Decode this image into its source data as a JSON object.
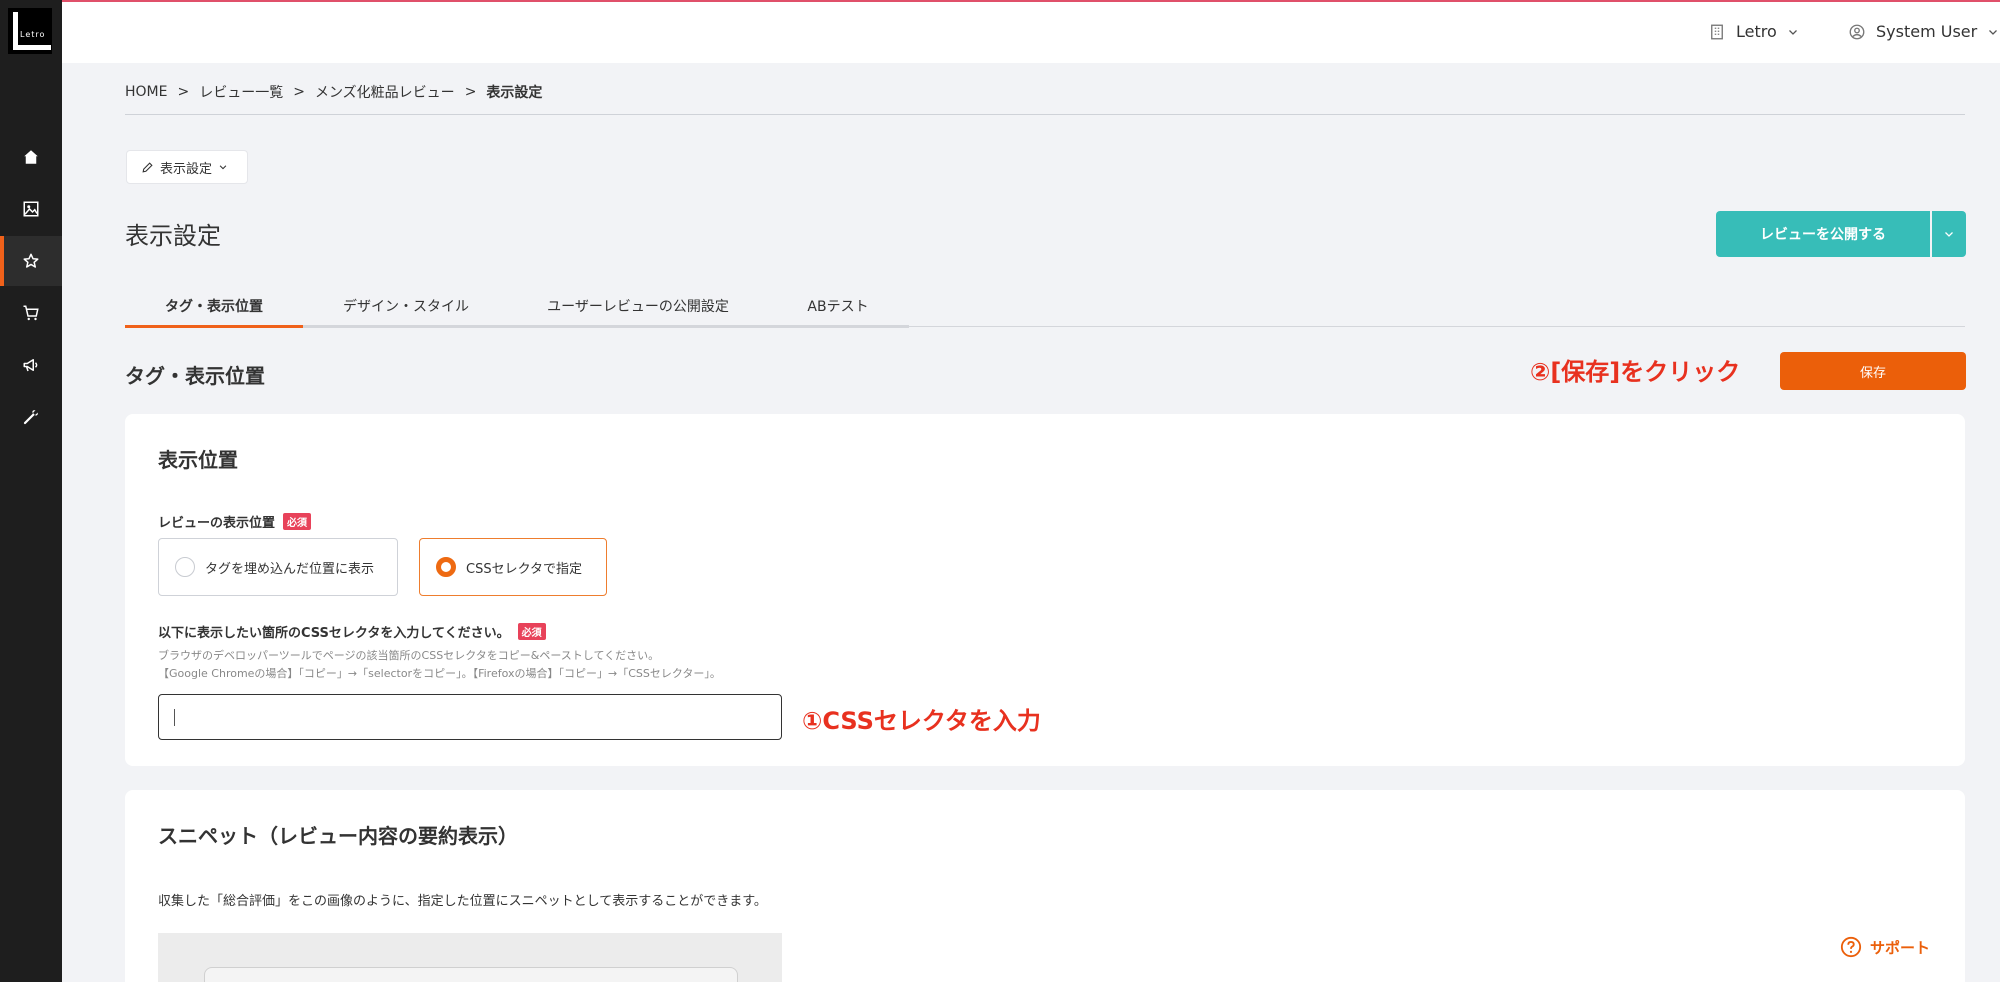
{
  "logo_text": "Letro",
  "header": {
    "org_name": "Letro",
    "user_name": "System User"
  },
  "breadcrumb": [
    "HOME",
    "レビュー一覧",
    "メンズ化粧品レビュー",
    "表示設定"
  ],
  "breadcrumb_sep": ">",
  "chip_label": "表示設定",
  "page_title": "表示設定",
  "publish_label": "レビューを公開する",
  "tabs": [
    {
      "label": "タグ・表示位置"
    },
    {
      "label": "デザイン・スタイル"
    },
    {
      "label": "ユーザーレビューの公開設定"
    },
    {
      "label": "ABテスト"
    }
  ],
  "section_title": "タグ・表示位置",
  "annotation_save": "②[保存]をクリック",
  "save_label": "保存",
  "display_card": {
    "title": "表示位置",
    "position_label": "レビューの表示位置",
    "required": "必須",
    "options": [
      {
        "label": "タグを埋め込んだ位置に表示",
        "selected": false
      },
      {
        "label": "CSSセレクタで指定",
        "selected": true
      }
    ],
    "selector_label": "以下に表示したい箇所のCSSセレクタを入力してください。",
    "help_line1": "ブラウザのデベロッパーツールでページの該当箇所のCSSセレクタをコピー&ペーストしてください。",
    "help_line2": "【Google Chromeの場合】「コピー」→「selectorをコピー」。【Firefoxの場合】「コピー」→「CSSセレクター」。",
    "selector_value": "",
    "annotation_input": "①CSSセレクタを入力"
  },
  "snippet_card": {
    "title": "スニペット（レビュー内容の要約表示）",
    "description": "収集した「総合評価」をこの画像のように、指定した位置にスニペットとして表示することができます。"
  },
  "support_label": "サポート",
  "colors": {
    "accent_orange": "#eb5f0a",
    "teal": "#37bdb8",
    "required_red": "#e8425a",
    "annotation_red": "#e8311f"
  }
}
